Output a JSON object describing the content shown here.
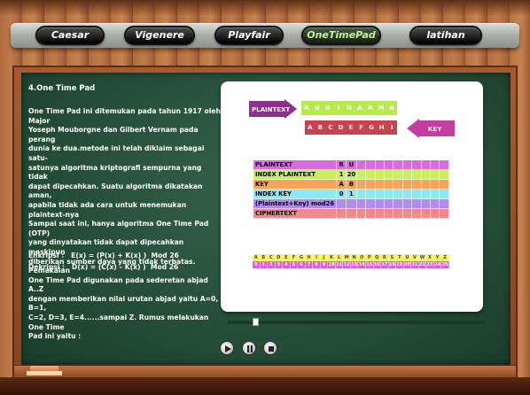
{
  "nav": {
    "items": [
      {
        "label": "Caesar",
        "active": false
      },
      {
        "label": "Vigenere",
        "active": false
      },
      {
        "label": "Playfair",
        "active": false
      },
      {
        "label": "OneTimePad",
        "active": true
      },
      {
        "label": "latihan",
        "active": false
      }
    ]
  },
  "lesson": {
    "title": "4.One Time Pad",
    "lines": [
      "One Time Pad ini ditemukan pada tahun 1917 oleh Major",
      "Yoseph Mouborgne dan Gilbert Vernam pada perang",
      "dunia ke dua.metode ini telah diklaim sebagai satu-",
      "satunya algoritma kriptografi sempurna yang tidak",
      "dapat dipecahkan. Suatu algoritma dikatakan aman,",
      "apabila tidak ada cara untuk menemukan plaintext-nya",
      "Sampai saat ini, hanya algoritma One Time Pad (OTP)",
      "yang dinyatakan tidak dapat dipecahkan meskipun",
      "diberikan sumber daya yang tidak terbatas. Pemakaian",
      "One Time Pad digunakan pada sederetan abjad A..Z",
      "dengan memberikan nilai urutan abjad yaitu A=0, B=1,",
      "C=2, D=3, E=4......sampai Z. Rumus melakukan One Time",
      "Pad ini yaitu :"
    ],
    "encrypt_label": "Enkripsi :",
    "encrypt_formula": "E(x) = (P(x) + K(x) )  Mod 26",
    "decrypt_label": "Dekripsi :",
    "decrypt_formula": "D(x) = (C(x) – K(x) )  Mod 26"
  },
  "demo": {
    "plaintext_tag": "PLAINTEXT",
    "key_tag": "KEY",
    "plaintext_letters": [
      "R",
      "U",
      "D",
      "I",
      "D",
      "A",
      "R",
      "M",
      "A"
    ],
    "key_letters": [
      "A",
      "B",
      "C",
      "D",
      "E",
      "F",
      "G",
      "H",
      "I"
    ],
    "table": [
      {
        "label": "PLAINTEXT",
        "cells": [
          "R",
          "U"
        ],
        "color": "#d96ae0"
      },
      {
        "label": "INDEX PLAINTEXT",
        "cells": [
          "1",
          "20"
        ],
        "color": "#c9ee62"
      },
      {
        "label": "KEY",
        "cells": [
          "A",
          "B"
        ],
        "color": "#f7a35a"
      },
      {
        "label": "INDEX KEY",
        "cells": [
          "0",
          "1"
        ],
        "color": "#8fe8ef"
      },
      {
        "label": "(Plaintext+Key) mod26",
        "cells": [
          "",
          ""
        ],
        "color": "#b58af0"
      },
      {
        "label": "CIPHERTEXT",
        "cells": [
          "",
          ""
        ],
        "color": "#f08a8a"
      }
    ],
    "alphabet": [
      "A",
      "B",
      "C",
      "D",
      "E",
      "F",
      "G",
      "H",
      "I",
      "J",
      "K",
      "L",
      "M",
      "N",
      "O",
      "P",
      "Q",
      "R",
      "S",
      "T",
      "U",
      "V",
      "W",
      "X",
      "Y",
      "Z"
    ],
    "numbers": [
      "0",
      "1",
      "2",
      "3",
      "4",
      "5",
      "6",
      "7",
      "8",
      "9",
      "10",
      "11",
      "12",
      "13",
      "14",
      "15",
      "16",
      "17",
      "18",
      "19",
      "20",
      "21",
      "22",
      "23",
      "24",
      "25"
    ]
  },
  "player": {
    "progress": 0.1
  },
  "colors": {
    "plaintext_tag": "#8e2f8c",
    "key_tag": "#c23fa0",
    "plaintext_strip": "#b7ea4f",
    "key_strip": "#c8434f",
    "alpha_top": "#f7f35c",
    "alpha_bottom": "#e05fd8"
  }
}
